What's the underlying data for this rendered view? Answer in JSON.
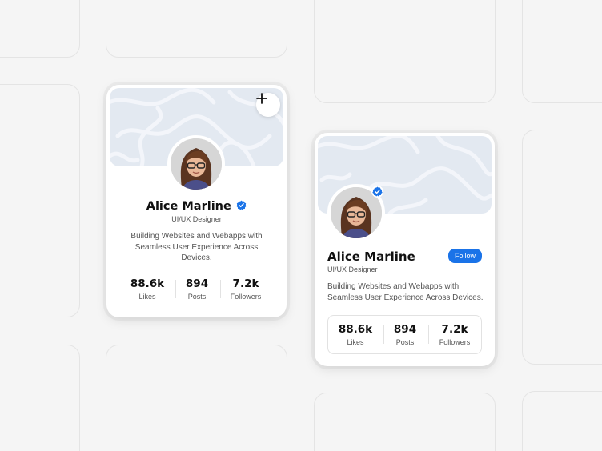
{
  "colors": {
    "background": "#f5f5f5",
    "card": "#ffffff",
    "cover": "#e3e9f1",
    "accent": "#1a73e8",
    "verified": "#1a73e8"
  },
  "card_centered": {
    "name": "Alice Marline",
    "role": "UI/UX Designer",
    "bio_lines": [
      "Building Websites and Webapps with",
      "Seamless User Experience Across",
      "Devices."
    ],
    "add_icon": "plus-icon",
    "stats": [
      {
        "value": "88.6k",
        "label": "Likes"
      },
      {
        "value": "894",
        "label": "Posts"
      },
      {
        "value": "7.2k",
        "label": "Followers"
      }
    ]
  },
  "card_left": {
    "name": "Alice Marline",
    "role": "UI/UX Designer",
    "follow_label": "Follow",
    "bio_lines": [
      "Building Websites and Webapps with",
      "Seamless User Experience Across Devices."
    ],
    "stats": [
      {
        "value": "88.6k",
        "label": "Likes"
      },
      {
        "value": "894",
        "label": "Posts"
      },
      {
        "value": "7.2k",
        "label": "Followers"
      }
    ]
  }
}
